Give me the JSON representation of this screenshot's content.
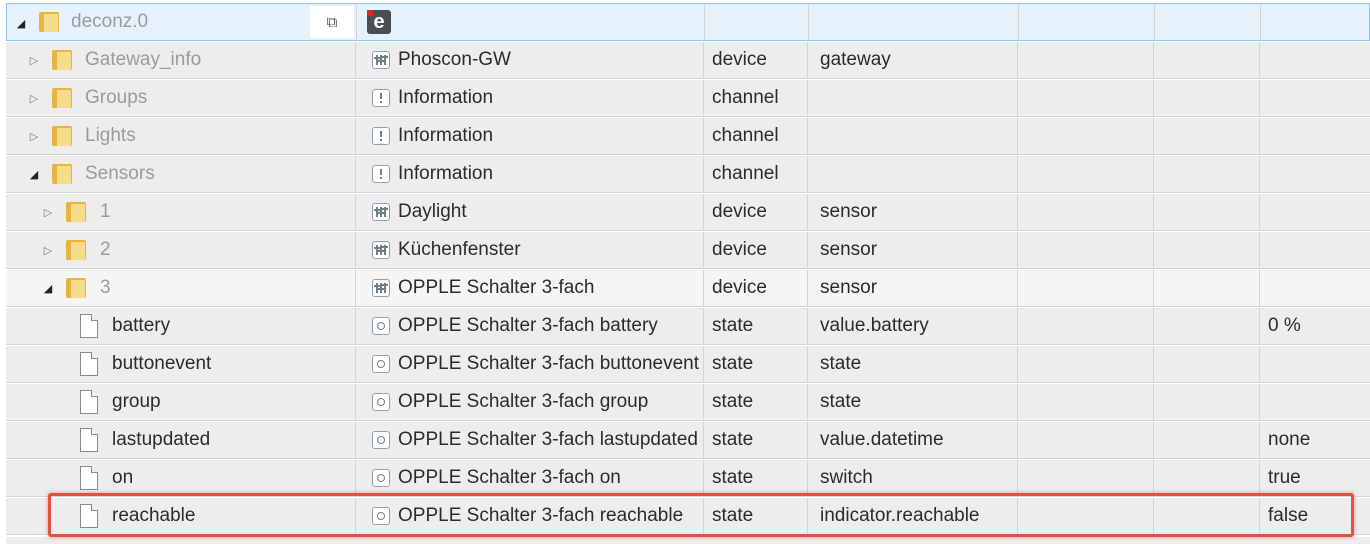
{
  "adapter": {
    "label": "deconz.0",
    "copy_icon": "copy-icon",
    "logo_letter": "e"
  },
  "rows": [
    {
      "id": "Gateway_info",
      "name": "Phoscon-GW",
      "type": "device",
      "role": "gateway",
      "value": ""
    },
    {
      "id": "Groups",
      "name": "Information",
      "type": "channel",
      "role": "",
      "value": ""
    },
    {
      "id": "Lights",
      "name": "Information",
      "type": "channel",
      "role": "",
      "value": ""
    },
    {
      "id": "Sensors",
      "name": "Information",
      "type": "channel",
      "role": "",
      "value": ""
    },
    {
      "id": "1",
      "name": "Daylight",
      "type": "device",
      "role": "sensor",
      "value": ""
    },
    {
      "id": "2",
      "name": "Küchenfenster",
      "type": "device",
      "role": "sensor",
      "value": ""
    },
    {
      "id": "3",
      "name": "OPPLE Schalter 3-fach",
      "type": "device",
      "role": "sensor",
      "value": ""
    },
    {
      "id": "battery",
      "name": "OPPLE Schalter 3-fach battery",
      "type": "state",
      "role": "value.battery",
      "value": "0 %"
    },
    {
      "id": "buttonevent",
      "name": "OPPLE Schalter 3-fach buttonevent",
      "type": "state",
      "role": "state",
      "value": ""
    },
    {
      "id": "group",
      "name": "OPPLE Schalter 3-fach group",
      "type": "state",
      "role": "state",
      "value": ""
    },
    {
      "id": "lastupdated",
      "name": "OPPLE Schalter 3-fach lastupdated",
      "type": "state",
      "role": "value.datetime",
      "value": "none"
    },
    {
      "id": "on",
      "name": "OPPLE Schalter 3-fach on",
      "type": "state",
      "role": "switch",
      "value": "true"
    },
    {
      "id": "reachable",
      "name": "OPPLE Schalter 3-fach reachable",
      "type": "state",
      "role": "indicator.reachable",
      "value": "false"
    }
  ]
}
